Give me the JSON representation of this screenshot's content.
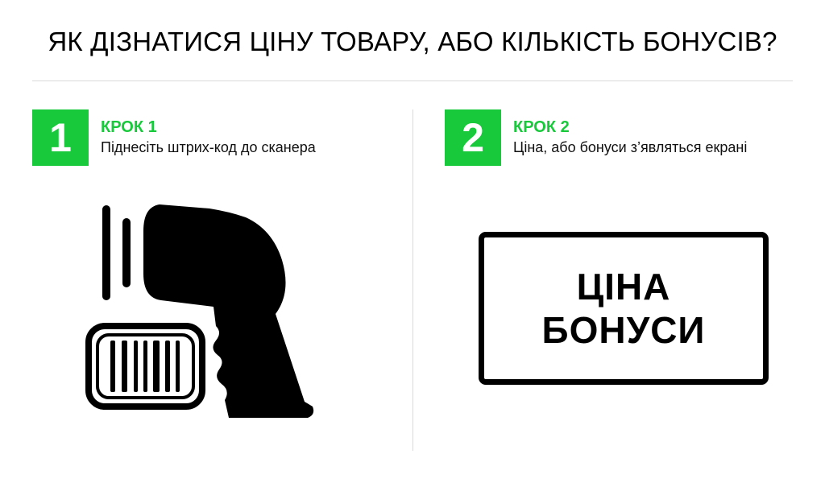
{
  "title": "ЯК ДІЗНАТИСЯ ЦІНУ ТОВАРУ, АБО КІЛЬКІСТЬ БОНУСІВ?",
  "colors": {
    "accent": "#17c93b",
    "text": "#000000",
    "divider": "#d9d9d9"
  },
  "steps": [
    {
      "number": "1",
      "heading": "КРОК 1",
      "description": "Піднесіть штрих-код до сканера",
      "icon": "barcode-scanner-icon"
    },
    {
      "number": "2",
      "heading": "КРОК 2",
      "description": "Ціна, або бонуси з’являться екрані",
      "icon": "display-screen-icon"
    }
  ],
  "display": {
    "line1": "ЦІНА",
    "line2": "БОНУСИ"
  }
}
